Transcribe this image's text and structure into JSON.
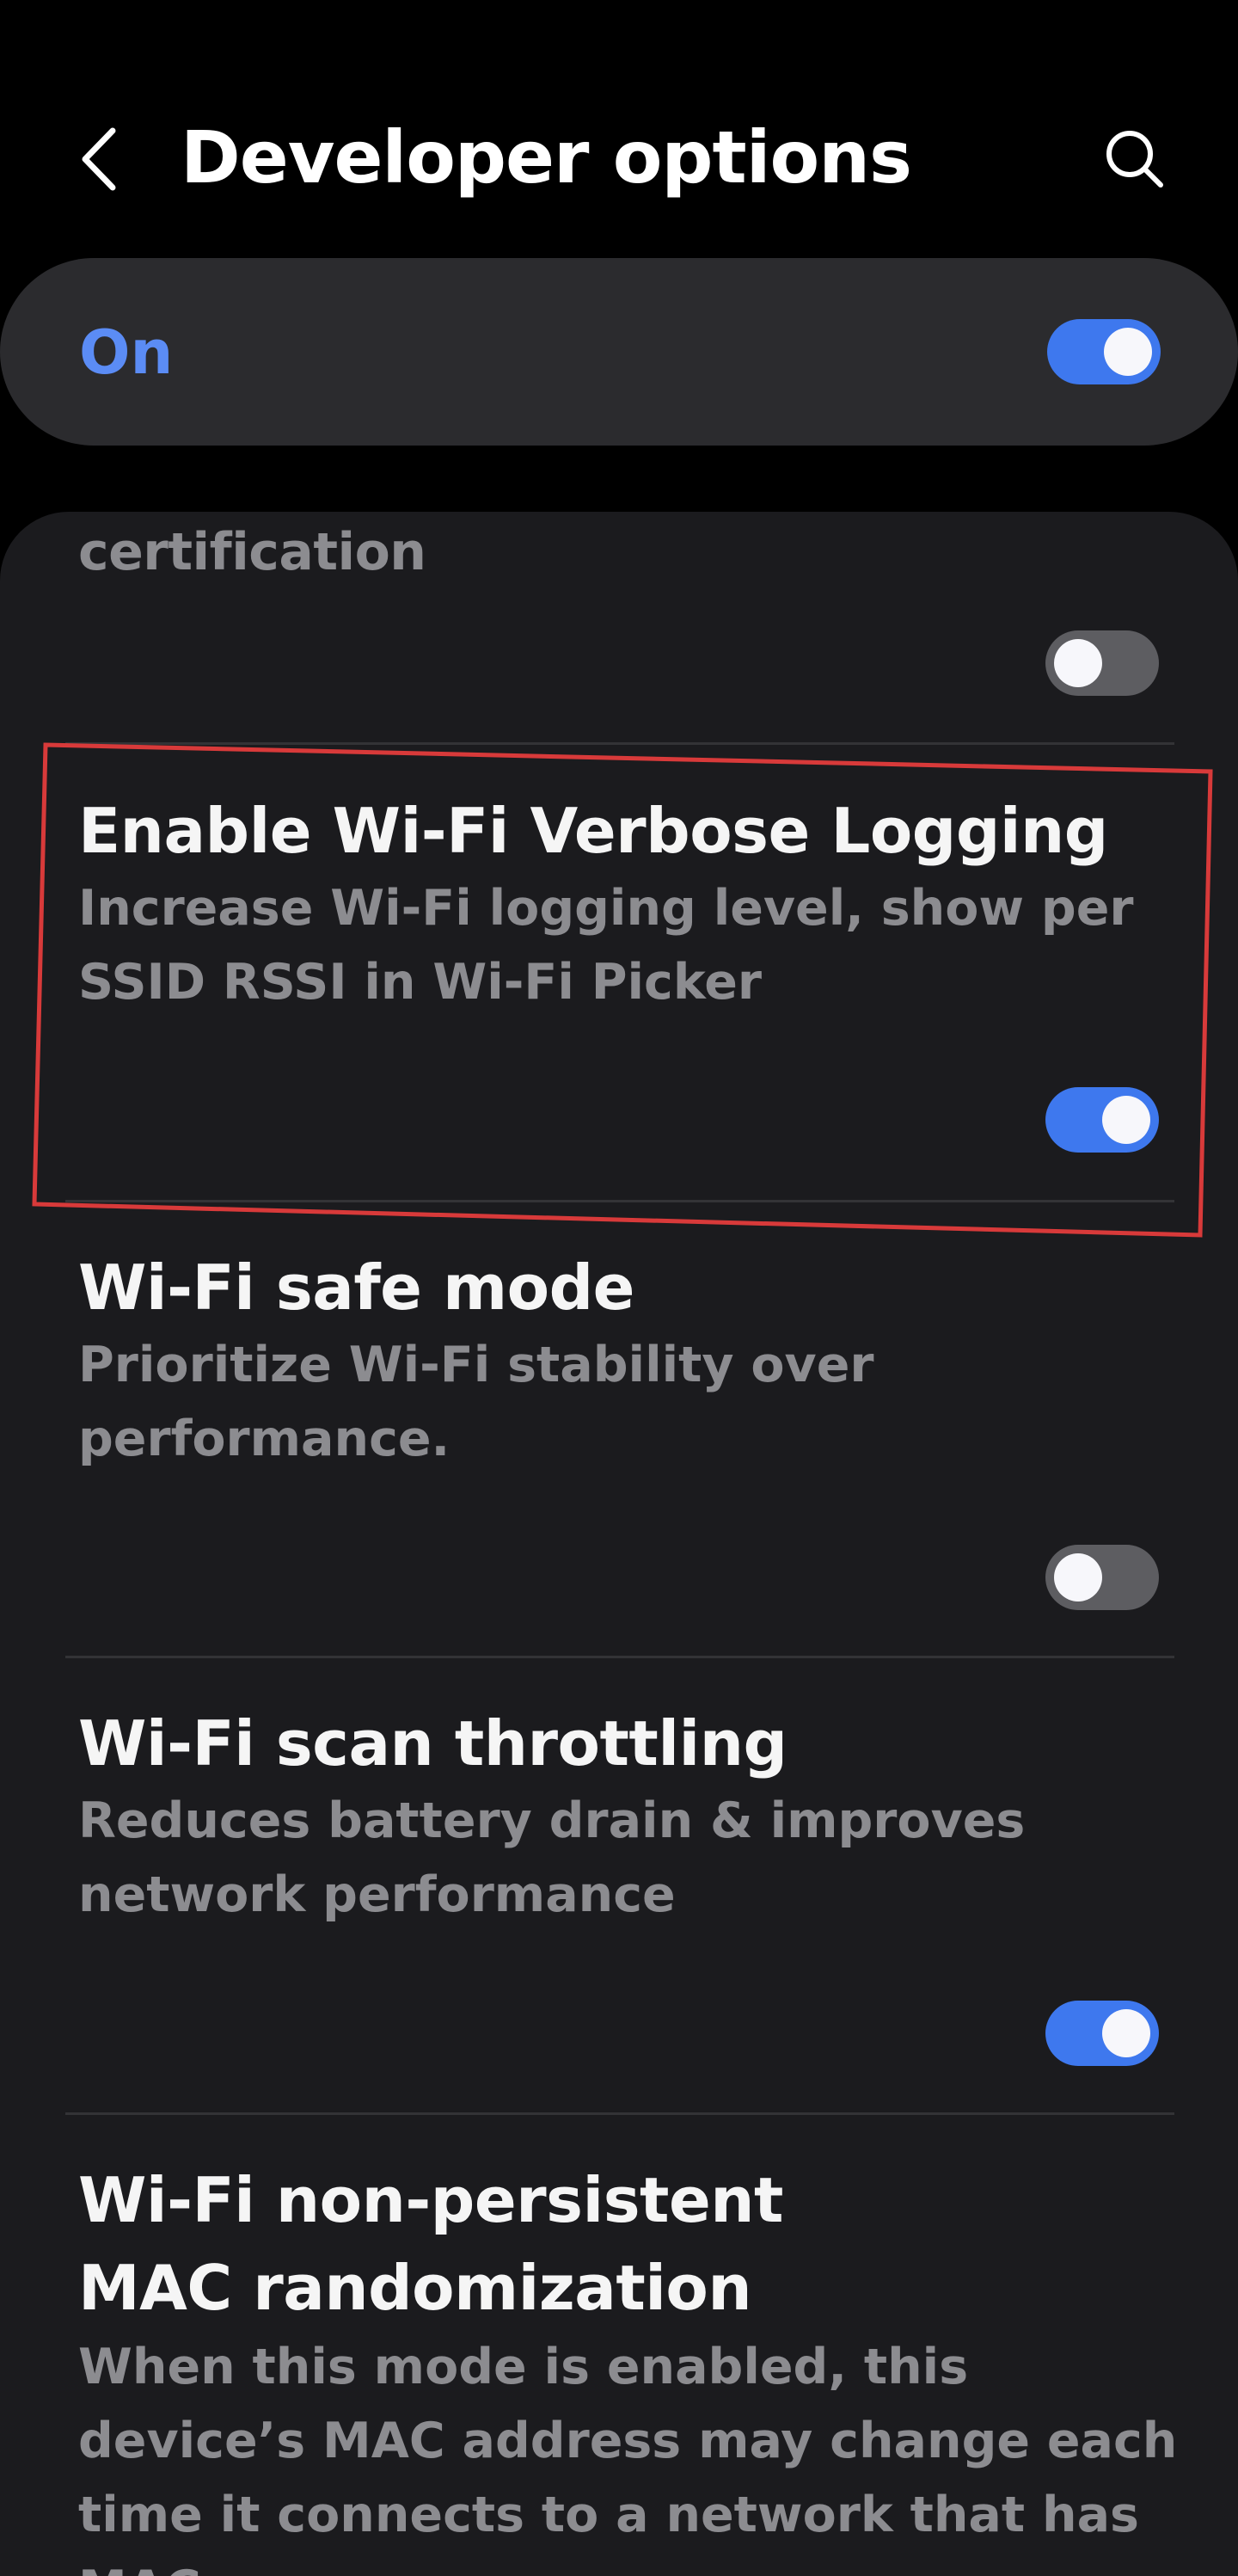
{
  "header": {
    "title": "Developer options",
    "back_icon": "chevron-left-icon",
    "search_icon": "search-icon"
  },
  "master_switch": {
    "label": "On",
    "state": "on"
  },
  "colors": {
    "accent": "#3e78ee",
    "on_label": "#5b8cf5",
    "highlight": "#d83a3a"
  },
  "settings": [
    {
      "title": "certification",
      "summary": "",
      "toggle": "off"
    },
    {
      "title": "Enable Wi-Fi Verbose Logging",
      "summary": "Increase Wi-Fi logging level, show per SSID RSSI in Wi-Fi Picker",
      "toggle": "on"
    },
    {
      "title": "Wi-Fi safe mode",
      "summary": "Prioritize Wi-Fi stability over performance.",
      "toggle": "off"
    },
    {
      "title": "Wi-Fi scan throttling",
      "summary": "Reduces battery drain & improves network performance",
      "toggle": "on"
    },
    {
      "title": "Wi-Fi non-persistent MAC randomization",
      "summary": "When this mode is enabled, this device’s MAC address may change each time it connects to a network that has MAC",
      "toggle": null
    }
  ]
}
